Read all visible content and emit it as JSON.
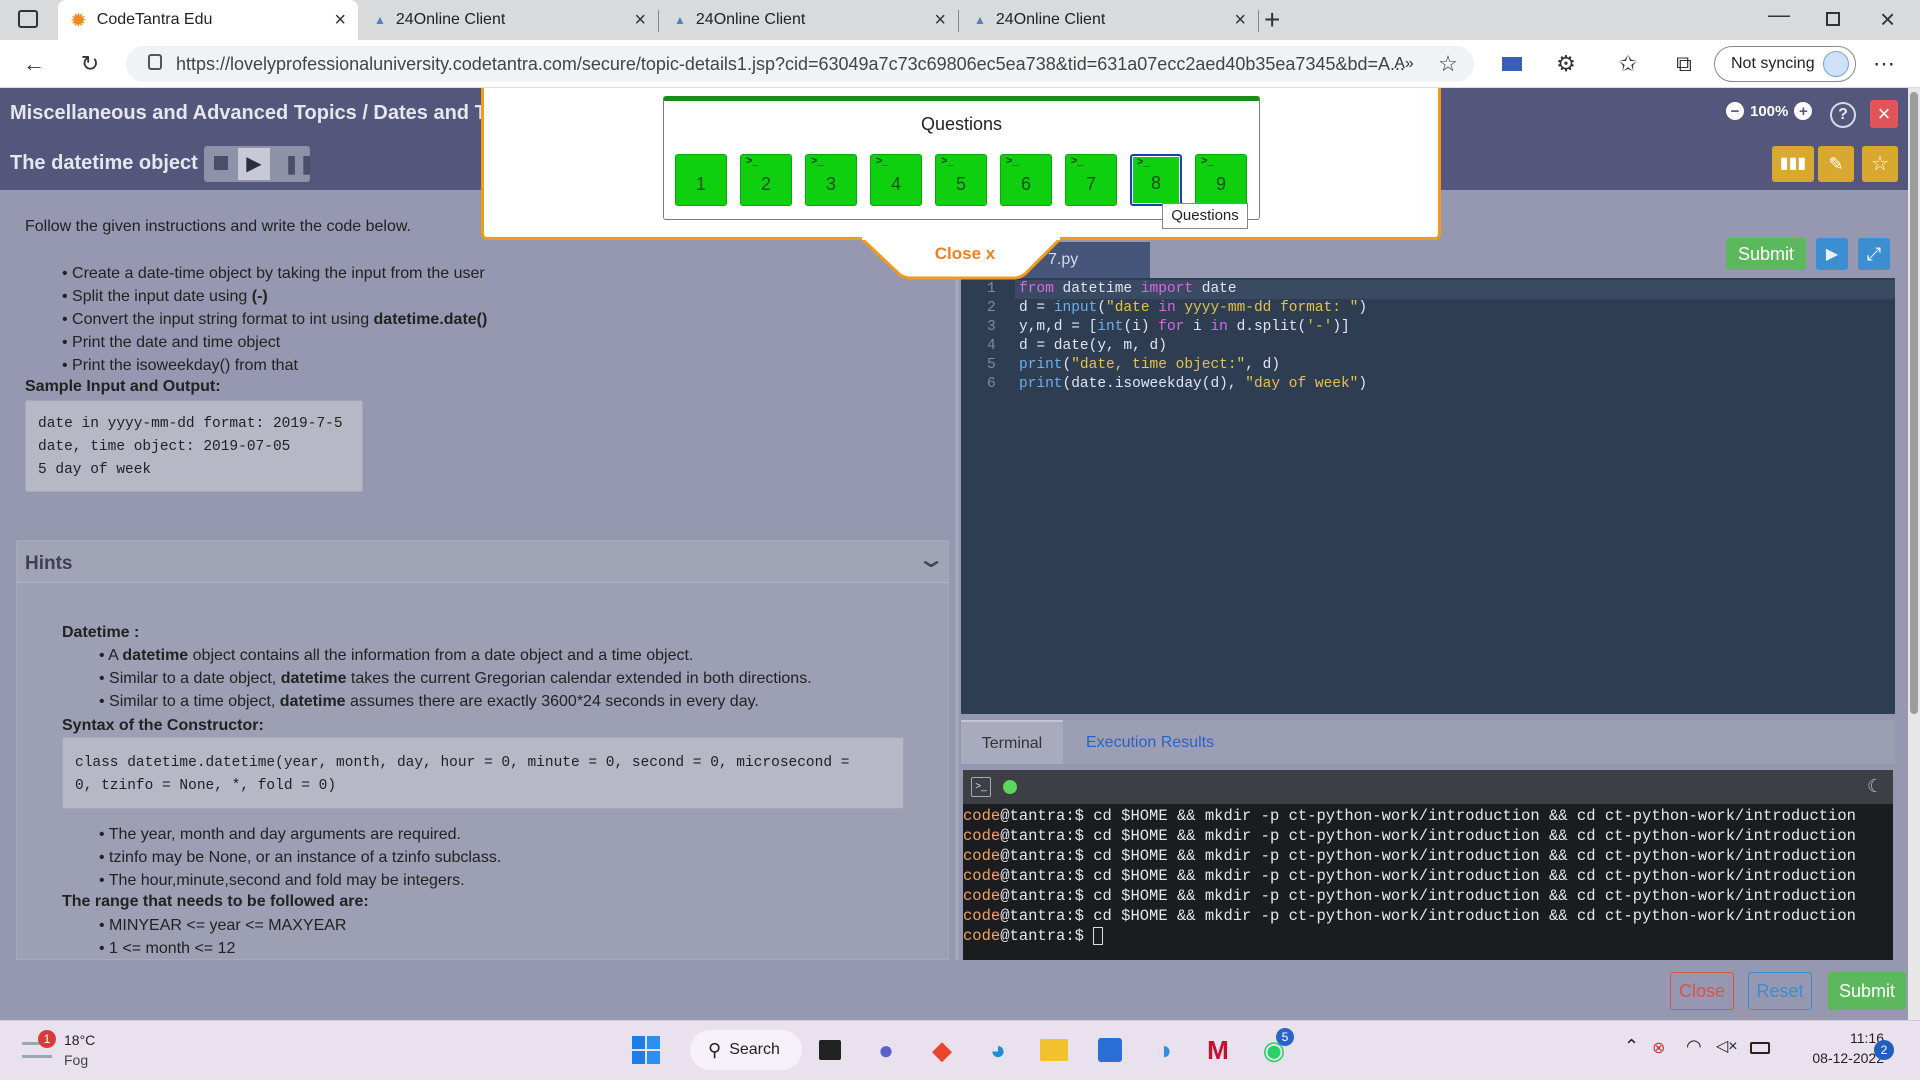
{
  "browser": {
    "tabs": [
      {
        "title": "CodeTantra Edu",
        "active": true
      },
      {
        "title": "24Online Client",
        "active": false
      },
      {
        "title": "24Online Client",
        "active": false
      },
      {
        "title": "24Online Client",
        "active": false
      }
    ],
    "url": "https://lovelyprofessionaluniversity.codetantra.com/secure/topic-details1.jsp?cid=63049a7c73c69806ec5ea738&tid=631a07ecc2aed40b35ea7345&bd=A...",
    "sync_label": "Not syncing"
  },
  "header": {
    "breadcrumb": "Miscellaneous and Advanced Topics / Dates and Ti",
    "topic_title": "The datetime object",
    "zoom": "100%",
    "help": "?",
    "close": "×"
  },
  "questions_modal": {
    "title": "Questions",
    "items": [
      "1",
      "2",
      "3",
      "4",
      "5",
      "6",
      "7",
      "8",
      "9"
    ],
    "selected": "8",
    "tooltip": "Questions",
    "close_label": "Close x"
  },
  "instructions": {
    "intro": "Follow the given instructions and write the code below.",
    "bullets": [
      {
        "pre": "Create a date-time object by taking the input from the user",
        "bold": "",
        "post": ""
      },
      {
        "pre": "Split the input date using ",
        "bold": "(-)",
        "post": ""
      },
      {
        "pre": "Convert the input string format to int using ",
        "bold": "datetime.date()",
        "post": ""
      },
      {
        "pre": "Print the date and time object",
        "bold": "",
        "post": ""
      },
      {
        "pre": "Print the isoweekday() from that",
        "bold": "",
        "post": ""
      }
    ],
    "sample_heading": "Sample Input and Output:",
    "sample_lines": [
      "date in yyyy-mm-dd format: 2019-7-5",
      "date, time object: 2019-07-05",
      "5 day of week"
    ]
  },
  "hints": {
    "title": "Hints",
    "datetime_heading": "Datetime :",
    "datetime_bullets": [
      {
        "pre": "A ",
        "bold": "datetime",
        "post": " object contains all the information from a date object and a time object."
      },
      {
        "pre": "Similar to a date object, ",
        "bold": "datetime",
        "post": " takes the current Gregorian calendar extended in both directions."
      },
      {
        "pre": "Similar to a time object, ",
        "bold": "datetime",
        "post": " assumes there are exactly 3600*24 seconds in every day."
      }
    ],
    "syntax_heading": "Syntax of the Constructor:",
    "syntax_lines": [
      "class datetime.datetime(year, month, day, hour = 0, minute = 0, second = 0, microsecond =",
      "0, tzinfo = None, *, fold = 0)"
    ],
    "arg_bullets": [
      "The year, month and day arguments are required.",
      " tzinfo may be None, or an instance of a tzinfo subclass.",
      "The hour,minute,second and fold may be integers."
    ],
    "range_heading": "The range that needs to be followed are:",
    "range_bullets": [
      "MINYEAR <= year <= MAXYEAR",
      "1 <= month <= 12"
    ]
  },
  "editor": {
    "file_tab": "7.py",
    "submit_label": "Submit",
    "line_numbers": [
      "1",
      "2",
      "3",
      "4",
      "5",
      "6"
    ],
    "code": [
      "from datetime import date",
      "d = input(\"date in yyyy-mm-dd format: \")",
      "y,m,d = [int(i) for i in d.split('-')]",
      "d = date(y, m, d)",
      "print(\"date, time object:\", d)",
      "print(date.isoweekday(d), \"day of week\")"
    ]
  },
  "terminal": {
    "tab_terminal": "Terminal",
    "tab_results": "Execution Results",
    "prompt_user": "code",
    "prompt_host": "@tantra:$ ",
    "command": "cd $HOME && mkdir -p ct-python-work/introduction && cd ct-python-work/introduction",
    "repeat": 6
  },
  "footer": {
    "close_label": "Close",
    "reset_label": "Reset",
    "submit_label": "Submit"
  },
  "taskbar": {
    "weather_temp": "18°C",
    "weather_desc": "Fog",
    "weather_badge": "1",
    "search_label": "Search",
    "whatsapp_badge": "5",
    "time": "11:16",
    "date": "08-12-2022",
    "notif_badge": "2"
  },
  "colors": {
    "accent_green": "#5cb85c",
    "question_green": "#0ed00e",
    "header_bg": "#54567b",
    "editor_bg": "#2f3d52",
    "modal_border": "#f29a1d"
  }
}
